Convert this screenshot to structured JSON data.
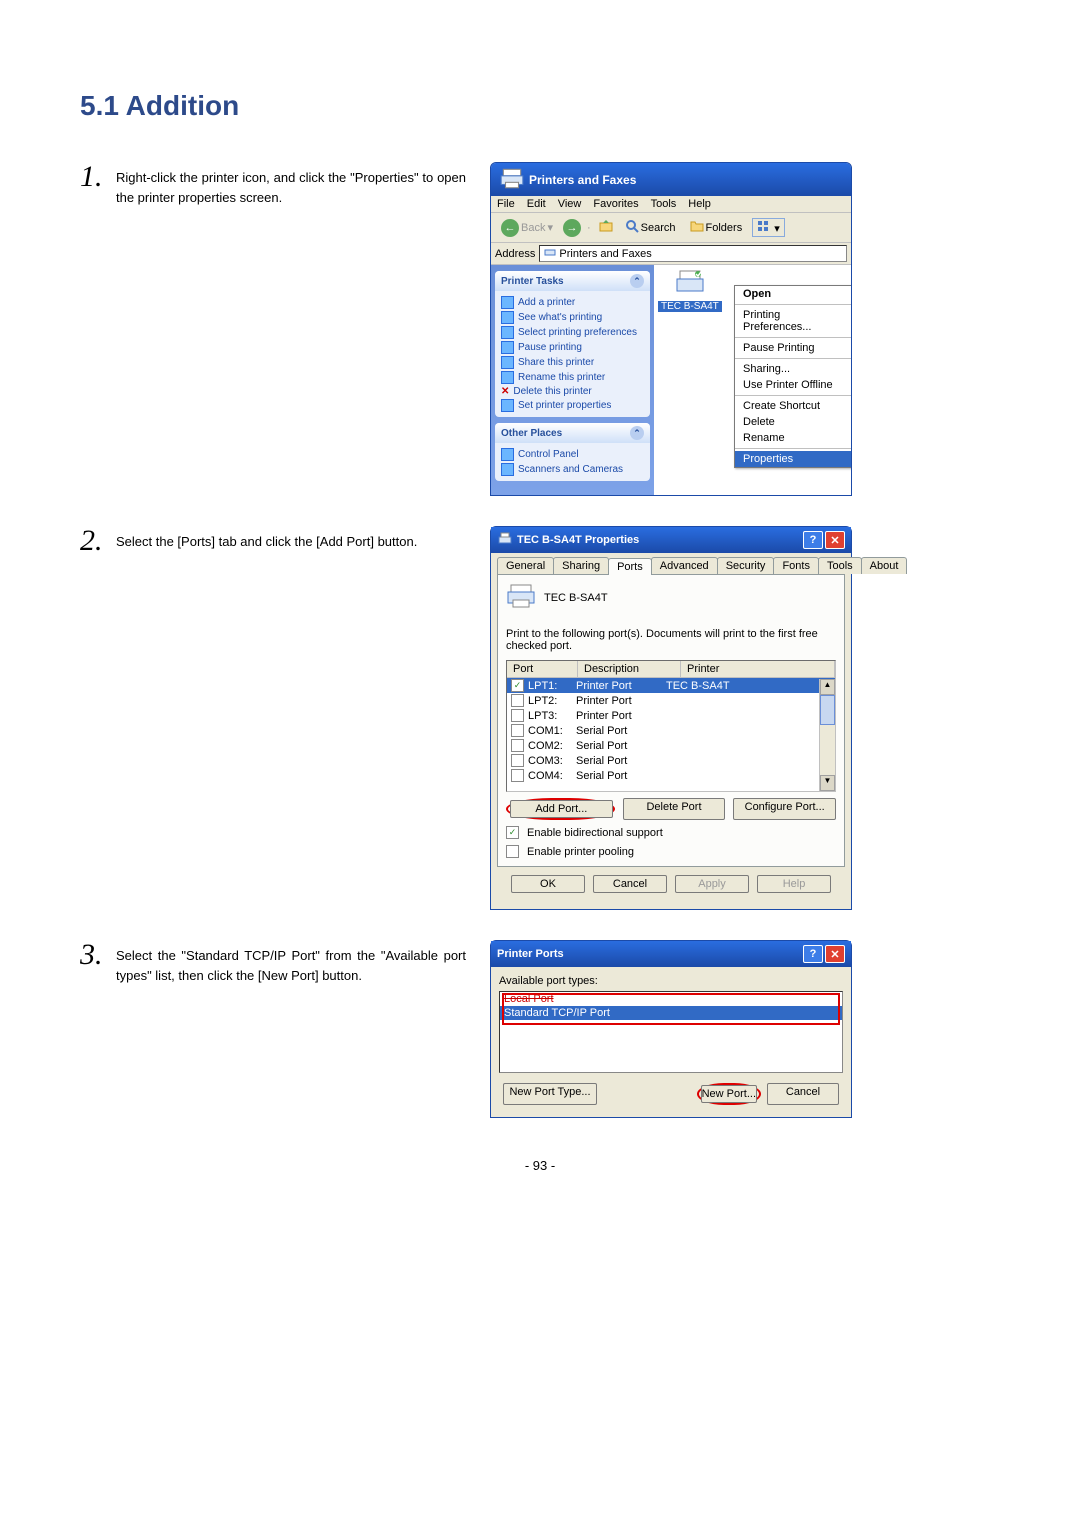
{
  "heading": "5.1  Addition",
  "steps": {
    "s1": {
      "num": "1.",
      "text": "Right-click the printer icon, and click the \"Properties\" to open the printer properties screen."
    },
    "s2": {
      "num": "2.",
      "text": "Select the [Ports] tab and click the [Add Port] button."
    },
    "s3": {
      "num": "3.",
      "text": "Select the \"Standard TCP/IP Port\" from the \"Available port types\" list, then click the [New Port] button."
    }
  },
  "printers_window": {
    "title": "Printers and Faxes",
    "menus": [
      "File",
      "Edit",
      "View",
      "Favorites",
      "Tools",
      "Help"
    ],
    "toolbar": {
      "back": "Back",
      "search": "Search",
      "folders": "Folders"
    },
    "address_label": "Address",
    "address_value": "Printers and Faxes",
    "tasks_title": "Printer Tasks",
    "tasks": [
      "Add a printer",
      "See what's printing",
      "Select printing preferences",
      "Pause printing",
      "Share this printer",
      "Rename this printer",
      "Delete this printer",
      "Set printer properties"
    ],
    "other_title": "Other Places",
    "other": [
      "Control Panel",
      "Scanners and Cameras"
    ],
    "printer_name": "TEC B-SA4T",
    "context_menu": [
      {
        "label": "Open",
        "bold": true
      },
      {
        "sep": true
      },
      {
        "label": "Printing Preferences..."
      },
      {
        "sep": true
      },
      {
        "label": "Pause Printing"
      },
      {
        "sep": true
      },
      {
        "label": "Sharing..."
      },
      {
        "label": "Use Printer Offline"
      },
      {
        "sep": true
      },
      {
        "label": "Create Shortcut"
      },
      {
        "label": "Delete"
      },
      {
        "label": "Rename"
      },
      {
        "sep": true
      },
      {
        "label": "Properties",
        "selected": true
      }
    ]
  },
  "props_dialog": {
    "title": "TEC B-SA4T Properties",
    "tabs": [
      "General",
      "Sharing",
      "Ports",
      "Advanced",
      "Security",
      "Fonts",
      "Tools",
      "About"
    ],
    "active_tab": "Ports",
    "printer_name": "TEC B-SA4T",
    "instruction": "Print to the following port(s). Documents will print to the first free checked port.",
    "columns": {
      "port": "Port",
      "desc": "Description",
      "printer": "Printer"
    },
    "rows": [
      {
        "checked": true,
        "port": "LPT1:",
        "desc": "Printer Port",
        "printer": "TEC B-SA4T",
        "selected": true
      },
      {
        "checked": false,
        "port": "LPT2:",
        "desc": "Printer Port",
        "printer": ""
      },
      {
        "checked": false,
        "port": "LPT3:",
        "desc": "Printer Port",
        "printer": ""
      },
      {
        "checked": false,
        "port": "COM1:",
        "desc": "Serial Port",
        "printer": ""
      },
      {
        "checked": false,
        "port": "COM2:",
        "desc": "Serial Port",
        "printer": ""
      },
      {
        "checked": false,
        "port": "COM3:",
        "desc": "Serial Port",
        "printer": ""
      },
      {
        "checked": false,
        "port": "COM4:",
        "desc": "Serial Port",
        "printer": ""
      }
    ],
    "buttons": {
      "add": "Add Port...",
      "delete": "Delete Port",
      "configure": "Configure Port..."
    },
    "bidi": "Enable bidirectional support",
    "pool": "Enable printer pooling",
    "footer": {
      "ok": "OK",
      "cancel": "Cancel",
      "apply": "Apply",
      "help": "Help"
    }
  },
  "ports_dialog": {
    "title": "Printer Ports",
    "label": "Available port types:",
    "items": [
      {
        "label": "Local Port",
        "strike": true
      },
      {
        "label": "Standard TCP/IP Port",
        "selected": true
      }
    ],
    "footer": {
      "new_type": "New Port Type...",
      "new_port": "New Port...",
      "cancel": "Cancel"
    }
  },
  "page_number": "- 93 -"
}
